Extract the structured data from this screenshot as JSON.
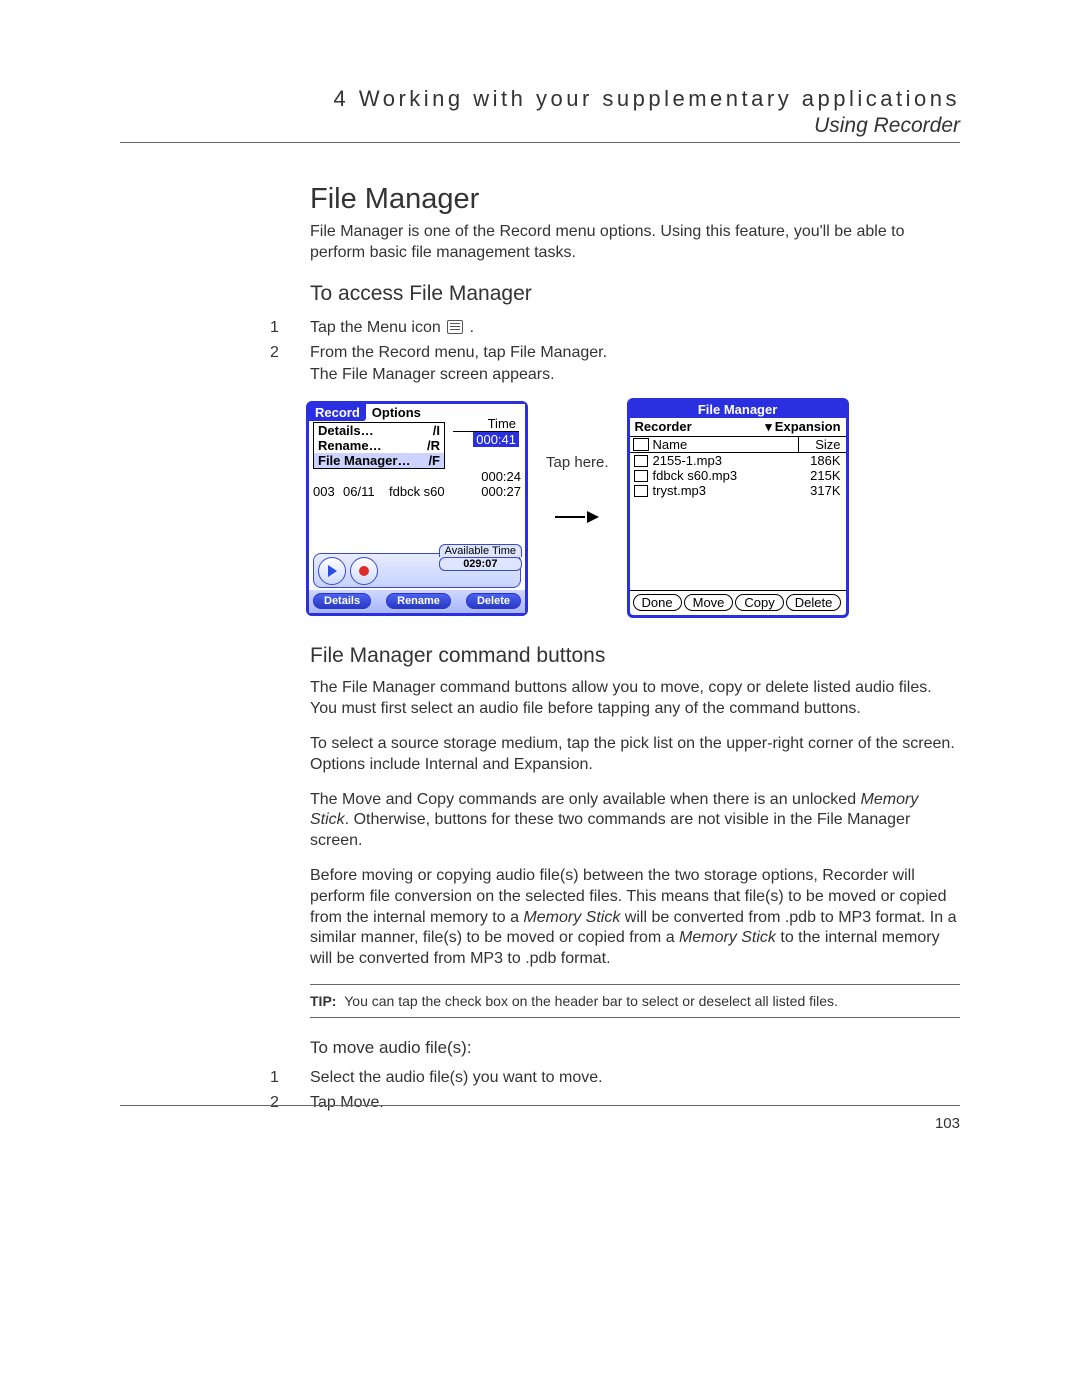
{
  "header": {
    "chapter": "4 Working with your supplementary applications",
    "subtitle": "Using Recorder"
  },
  "section_title": "File Manager",
  "intro": "File Manager is one of the Record menu options. Using this feature, you'll be able to perform basic file management tasks.",
  "sub_access": "To access File Manager",
  "steps_access": {
    "s1_pre": "Tap the Menu icon ",
    "s1_post": ".",
    "s2": "From the Record menu, tap File Manager.",
    "s2_note": "The File Manager screen appears."
  },
  "record_screen": {
    "tab_record": "Record",
    "tab_options": "Options",
    "menu": [
      {
        "label": "Details…",
        "sc": "/I"
      },
      {
        "label": "Rename…",
        "sc": "/R"
      },
      {
        "label": "File Manager…",
        "sc": "/F"
      }
    ],
    "time_header": "Time",
    "time_selected": "000:41",
    "rows_partial": [
      {
        "c1": "",
        "c2": "",
        "c3": "",
        "c4": "000:24"
      },
      {
        "c1": "003",
        "c2": "06/11",
        "c3": "fdbck s60",
        "c4": "000:27"
      }
    ],
    "available_label": "Available Time",
    "available_value": "029:07",
    "footer": [
      "Details",
      "Rename",
      "Delete"
    ]
  },
  "tap_here": "Tap here.",
  "fm_screen": {
    "title": "File Manager",
    "app": "Recorder",
    "source": "Expansion",
    "col_name": "Name",
    "col_size": "Size",
    "files": [
      {
        "name": "2155-1.mp3",
        "size": "186K"
      },
      {
        "name": "fdbck s60.mp3",
        "size": "215K"
      },
      {
        "name": "tryst.mp3",
        "size": "317K"
      }
    ],
    "buttons": [
      "Done",
      "Move",
      "Copy",
      "Delete"
    ]
  },
  "sub_cmd": "File Manager command buttons",
  "cmd_p1": "The File Manager command buttons allow you to move, copy or delete listed audio files. You must first select an audio file before tapping any of the command buttons.",
  "cmd_p2": "To select a source storage medium, tap the pick list on the upper-right corner of the screen. Options include Internal and Expansion.",
  "cmd_p3a": "The Move and Copy commands are only available when there is an unlocked ",
  "cmd_p3_em": "Memory Stick",
  "cmd_p3b": ". Otherwise, buttons for these two commands are not visible in the File Manager screen.",
  "cmd_p4a": "Before moving or copying audio file(s) between the two storage options, Recorder will perform file conversion on the selected files. This means that file(s) to be moved or copied from the internal memory to a ",
  "cmd_p4_em1": "Memory Stick",
  "cmd_p4b": " will be converted from .pdb to MP3 format. In a similar manner, file(s) to be moved or copied from a ",
  "cmd_p4_em2": "Memory Stick",
  "cmd_p4c": " to the internal memory will be converted from MP3 to .pdb format.",
  "tip_label": "TIP:",
  "tip_text": "You can tap the check box on the header bar to select or deselect all listed files.",
  "sub_move": "To move audio file(s):",
  "steps_move": {
    "s1": "Select the audio file(s) you want to move.",
    "s2": "Tap Move."
  },
  "page_number": "103"
}
